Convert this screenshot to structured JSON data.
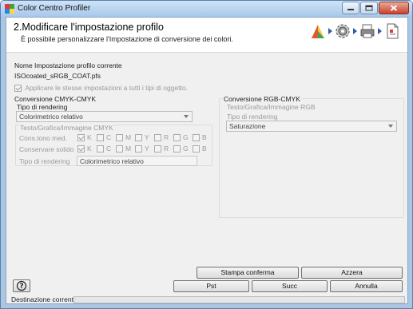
{
  "window": {
    "title": "Color Centro Profiler"
  },
  "header": {
    "title": "2.Modificare l'impostazione profilo",
    "subtitle": "È possibile personalizzare l'Impostazione di conversione dei colori."
  },
  "profile": {
    "name_label": "Nome Impostazione profilo corrente",
    "name_value": "ISOcoated_sRGB_COAT.pfs",
    "apply_all_label": "Applicare le stesse impostazioni a tutti i tipi di oggetto.",
    "apply_all_checked": true
  },
  "cmyk": {
    "group_title": "Conversione CMYK-CMYK",
    "rendering_label": "Tipo di rendering",
    "rendering_value": "Colorimetrico relativo",
    "sub_group_title": "Testo/Grafica/Immagine CMYK",
    "row1_label": "Cons.tono med.",
    "row2_label": "Conservare solido",
    "channels": [
      "K",
      "C",
      "M",
      "Y",
      "R",
      "G",
      "B"
    ],
    "rendering2_label": "Tipo di rendering",
    "rendering2_value": "Colorimetrico relativo"
  },
  "rgb": {
    "group_title": "Conversione RGB-CMYK",
    "sub_group_title": "Testo/Grafica/Immagine RGB",
    "rendering_label": "Tipo di rendering",
    "rendering_value": "Saturazione"
  },
  "buttons": {
    "print_confirm": "Stampa conferma",
    "reset": "Azzera",
    "prev": "Pst",
    "next": "Succ",
    "cancel": "Annulla"
  },
  "status": {
    "text": "Destinazione corrente"
  }
}
